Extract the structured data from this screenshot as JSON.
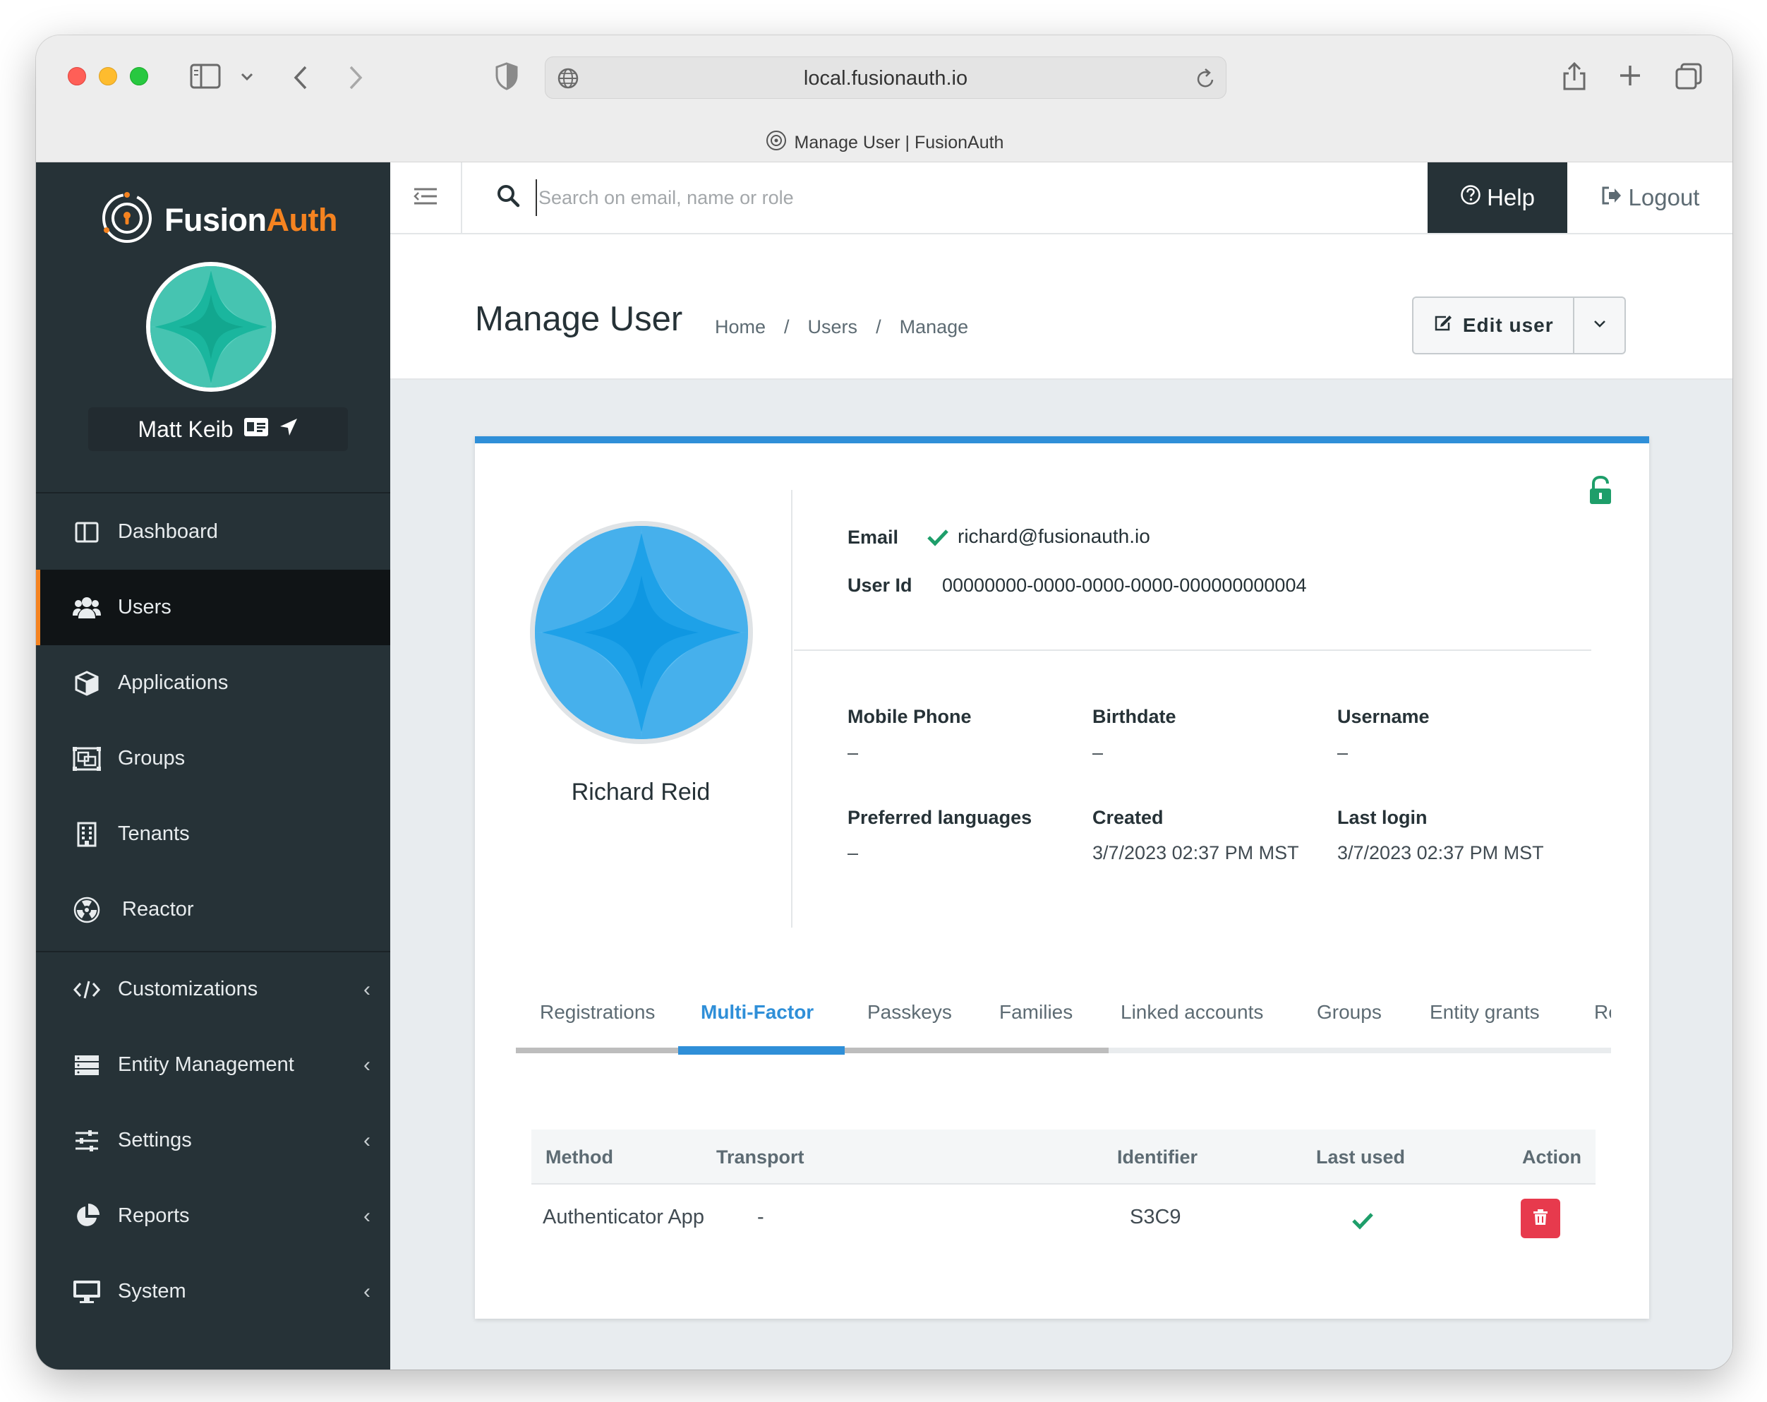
{
  "browser": {
    "url": "local.fusionauth.io",
    "tab_title": "Manage User | FusionAuth"
  },
  "sidebar": {
    "logo_part1": "Fusion",
    "logo_part2": "Auth",
    "user_name": "Matt Keib",
    "items": [
      {
        "label": "Dashboard",
        "icon": "dashboard-icon"
      },
      {
        "label": "Users",
        "icon": "users-icon",
        "active": true
      },
      {
        "label": "Applications",
        "icon": "cube-icon"
      },
      {
        "label": "Groups",
        "icon": "groups-icon"
      },
      {
        "label": "Tenants",
        "icon": "building-icon"
      },
      {
        "label": "Reactor",
        "icon": "radiation-icon"
      },
      {
        "label": "Customizations",
        "icon": "code-icon"
      },
      {
        "label": "Entity Management",
        "icon": "server-icon"
      },
      {
        "label": "Settings",
        "icon": "sliders-icon"
      },
      {
        "label": "Reports",
        "icon": "pie-chart-icon"
      },
      {
        "label": "System",
        "icon": "monitor-icon"
      }
    ]
  },
  "topbar": {
    "search_placeholder": "Search on email, name or role",
    "help_label": "Help",
    "logout_label": "Logout"
  },
  "page": {
    "title": "Manage User",
    "breadcrumb": [
      "Home",
      "Users",
      "Manage"
    ],
    "breadcrumb_sep": "/",
    "edit_label": "Edit user"
  },
  "user": {
    "name": "Richard Reid",
    "email_label": "Email",
    "email": "richard@fusionauth.io",
    "userid_label": "User Id",
    "userid": "00000000-0000-0000-0000-000000000004",
    "fields": [
      {
        "label": "Mobile Phone",
        "value": "–"
      },
      {
        "label": "Birthdate",
        "value": "–"
      },
      {
        "label": "Username",
        "value": "–"
      },
      {
        "label": "Preferred languages",
        "value": "–"
      },
      {
        "label": "Created",
        "value": "3/7/2023 02:37 PM MST"
      },
      {
        "label": "Last login",
        "value": "3/7/2023 02:37 PM MST"
      }
    ]
  },
  "tabs": [
    "Registrations",
    "Multi-Factor",
    "Passkeys",
    "Families",
    "Linked accounts",
    "Groups",
    "Entity grants",
    "Re"
  ],
  "active_tab": "Multi-Factor",
  "mfa_table": {
    "headers": [
      "Method",
      "Transport",
      "Identifier",
      "Last used",
      "Action"
    ],
    "rows": [
      {
        "method": "Authenticator App",
        "transport": "-",
        "identifier": "S3C9",
        "last_used_icon": "check-icon",
        "action_icon": "trash-icon"
      }
    ]
  },
  "colors": {
    "sidebar_bg": "#263237",
    "accent_orange": "#f58320",
    "accent_blue": "#2f8fd8",
    "success_green": "#1e9e6a",
    "danger_red": "#e73a4d"
  }
}
